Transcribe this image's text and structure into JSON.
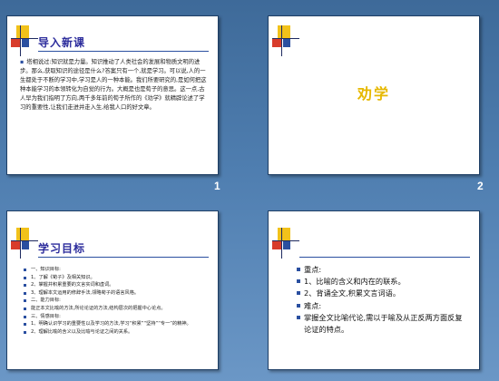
{
  "slides": [
    {
      "number": "1",
      "title": "导入新课",
      "paragraph": "塔相说过:知识就是力量。知识推动了人类社会的发展和物质文明的进步。那么,获取知识的途径是什么?答案只有一个,就是学习。可以说,人的一生都处于不断的学习中,学习是人的一种本能。我们所要研究的,是如何把这种本能学习的本领转化为自觉的行为。大概是也是荀子的意思。这一点,古人早为我们指明了方向,两千多年前的荀子所作的《劝学》就精辟论述了学习的重要性,让我们走进并走入生,给我人口的好文章。"
    },
    {
      "number": "2",
      "title": "劝学"
    },
    {
      "title": "学习目标",
      "items": [
        "一、知识目标:",
        "1、了解《荀子》及相关知识。",
        "2、掌握并积累重要的文言实词和虚词。",
        "3、理解本文运用的修辞手法,领略荀子的语言风格。",
        "二、能力目标:",
        "能正本文比喻的方法,所论论证的方法,结构层次的把握中心论点。",
        "三、情感目标:",
        "1、明确认识学习的重要性以及学习的方法,学习“积累”“坚持”“专一”的精神。",
        "2、理解比喻的含义以及比喻与论证之间的关系。"
      ]
    },
    {
      "items": [
        "重点:",
        "1、比喻的含义和内在的联系。",
        "2、背诵全文,积累文言词语。",
        "难点:",
        "掌握全文比喻代论,需以于喻及从正反两方面反复论证的特点。"
      ]
    }
  ],
  "colors": {
    "background": "#4f7eb0",
    "title_blue": "#2c2c9c",
    "title_gold": "#e6b800",
    "logo_yellow": "#f2c21a",
    "logo_red": "#d83c2b",
    "logo_blue": "#2a4fa0"
  }
}
